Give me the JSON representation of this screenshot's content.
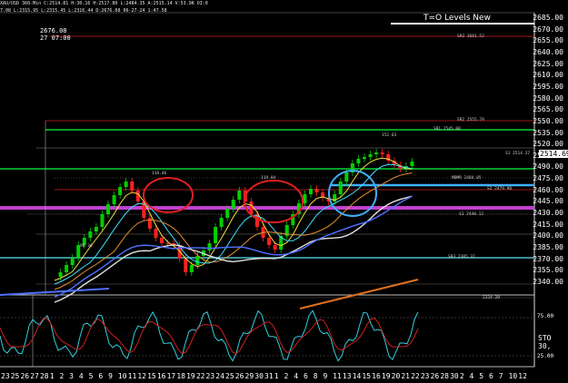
{
  "header": {
    "line1": "XAU/USD 360-Min  C:2514.81  H:30.16  H:2517.80  L:2484.35  A:2515.14  V:53.9K  OI:0",
    "line2": "7.08  L:2315.95  L:2315.45  L:2316.44  D:2676.08  06-27-24  1:47.58"
  },
  "stamps": {
    "price": "2676.08",
    "time": "27 07:00"
  },
  "study_title": "T=O Levels New",
  "price_axis": {
    "ticks": [
      "2685.00",
      "2670.00",
      "2655.00",
      "2640.00",
      "2625.00",
      "2610.00",
      "2595.00",
      "2580.00",
      "2565.00",
      "2550.00",
      "2535.00",
      "2520.00",
      "2505.00",
      "2490.00",
      "2475.00",
      "2460.00",
      "2445.00",
      "2430.00",
      "2415.00",
      "2400.00",
      "2385.00",
      "2370.00",
      "2355.00",
      "2340.00"
    ],
    "last_price": "2514.69"
  },
  "stochastic": {
    "label": "STO 30,",
    "levels": [
      "75.00",
      "25.00"
    ]
  },
  "date_axis": [
    "23",
    "25",
    "26",
    "27",
    "28",
    "1",
    "2",
    "3",
    "4",
    "5",
    "6",
    "9",
    "10",
    "11",
    "12",
    "15",
    "16",
    "17",
    "18",
    "19",
    "22",
    "23",
    "24",
    "25",
    "26",
    "29",
    "30",
    "31",
    "1",
    "2",
    "4",
    "6",
    "8",
    "9",
    "11",
    "13",
    "14",
    "15",
    "16",
    "19",
    "20",
    "21",
    "22",
    "23",
    "26",
    "28",
    "30",
    "2",
    "4",
    "5",
    "6",
    "7",
    "10",
    "12"
  ],
  "level_labels": {
    "r3": "SR3 2681.52",
    "r2": "SR2 2555.79",
    "r1": "SR1 2545.00",
    "h": "S1 2514.37",
    "mid": "MDMR 2484.05",
    "l": "S2 2479.90",
    "s1": "S1 2440.12",
    "s2": "SB3 2385.37",
    "s3": "2334.20"
  },
  "price_labels": {
    "p1": "118.46",
    "p2": "119.04",
    "p3": "152.63",
    "p4": "98.36"
  },
  "colors": {
    "background": "#000000",
    "magenta_level": "#c040d0",
    "green_level": "#00ff40",
    "red_level": "#d02020",
    "circle_red": "#e02020",
    "circle_blue": "#40b0ff",
    "up_candle": "#00d000",
    "down_candle": "#ff2020",
    "sto_k": "#30d0e0",
    "sto_d": "#d02020"
  }
}
